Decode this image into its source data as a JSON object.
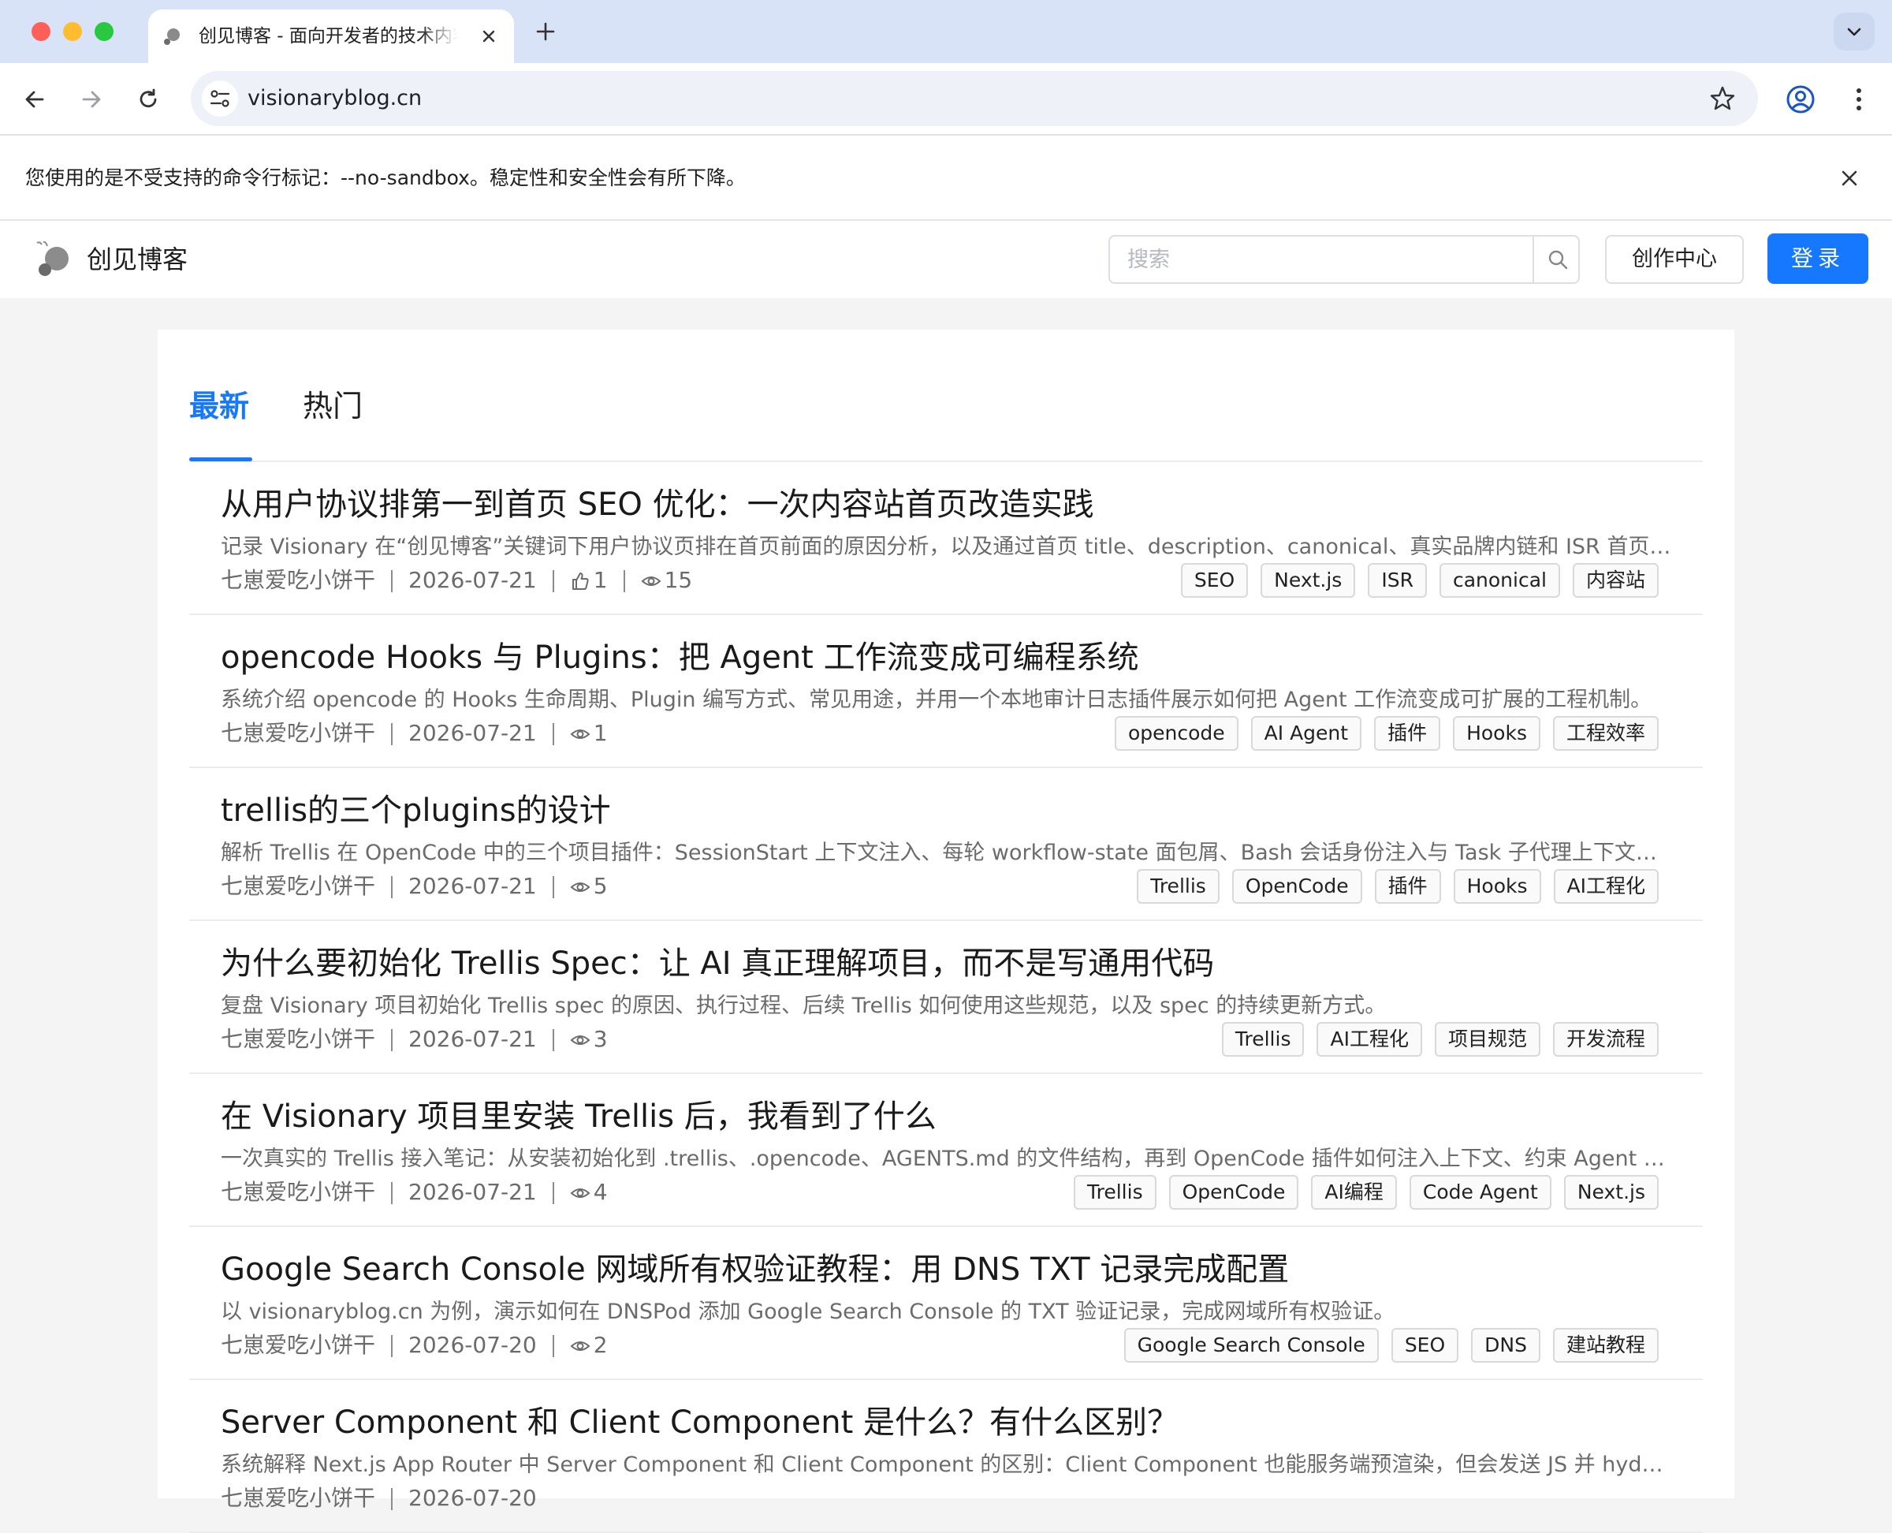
{
  "browser": {
    "tab_title": "创见博客 - 面向开发者的技术内容平台",
    "url": "visionaryblog.cn",
    "infobar_message": "您使用的是不受支持的命令行标记：--no-sandbox。稳定性和安全性会有所下降。"
  },
  "header": {
    "site_name": "创见博客",
    "search_placeholder": "搜索",
    "creator_label": "创作中心",
    "login_label": "登录"
  },
  "tabs": {
    "latest": "最新",
    "hot": "热门"
  },
  "articles": [
    {
      "title": "从用户协议排第一到首页 SEO 优化：一次内容站首页改造实践",
      "summary": "记录 Visionary 在“创见博客”关键词下用户协议页排在首页前面的原因分析，以及通过首页 title、description、canonical、真实品牌内链和 ISR 首页缓存等手段完成的首页 SEO 优化实践。",
      "author": "七崽爱吃小饼干",
      "date": "2026-07-21",
      "likes": "1",
      "views": "15",
      "tags": [
        "SEO",
        "Next.js",
        "ISR",
        "canonical",
        "内容站"
      ]
    },
    {
      "title": "opencode Hooks 与 Plugins：把 Agent 工作流变成可编程系统",
      "summary": "系统介绍 opencode 的 Hooks 生命周期、Plugin 编写方式、常见用途，并用一个本地审计日志插件展示如何把 Agent 工作流变成可扩展的工程机制。",
      "author": "七崽爱吃小饼干",
      "date": "2026-07-21",
      "views": "1",
      "tags": [
        "opencode",
        "AI Agent",
        "插件",
        "Hooks",
        "工程效率"
      ]
    },
    {
      "title": "trellis的三个plugins的设计",
      "summary": "解析 Trellis 在 OpenCode 中的三个项目插件：SessionStart 上下文注入、每轮 workflow-state 面包屑、Bash 会话身份注入与 Task 子代理上下文注入的设计思路。",
      "author": "七崽爱吃小饼干",
      "date": "2026-07-21",
      "views": "5",
      "tags": [
        "Trellis",
        "OpenCode",
        "插件",
        "Hooks",
        "AI工程化"
      ]
    },
    {
      "title": "为什么要初始化 Trellis Spec：让 AI 真正理解项目，而不是写通用代码",
      "summary": "复盘 Visionary 项目初始化 Trellis spec 的原因、执行过程、后续 Trellis 如何使用这些规范，以及 spec 的持续更新方式。",
      "author": "七崽爱吃小饼干",
      "date": "2026-07-21",
      "views": "3",
      "tags": [
        "Trellis",
        "AI工程化",
        "项目规范",
        "开发流程"
      ]
    },
    {
      "title": "在 Visionary 项目里安装 Trellis 后，我看到了什么",
      "summary": "一次真实的 Trellis 接入笔记：从安装初始化到 .trellis、.opencode、AGENTS.md 的文件结构，再到 OpenCode 插件如何注入上下文、约束 Agent 的工作流程。",
      "author": "七崽爱吃小饼干",
      "date": "2026-07-21",
      "views": "4",
      "tags": [
        "Trellis",
        "OpenCode",
        "AI编程",
        "Code Agent",
        "Next.js"
      ]
    },
    {
      "title": "Google Search Console 网域所有权验证教程：用 DNS TXT 记录完成配置",
      "summary": "以 visionaryblog.cn 为例，演示如何在 DNSPod 添加 Google Search Console 的 TXT 验证记录，完成网域所有权验证。",
      "author": "七崽爱吃小饼干",
      "date": "2026-07-20",
      "views": "2",
      "tags": [
        "Google Search Console",
        "SEO",
        "DNS",
        "建站教程"
      ]
    },
    {
      "title": "Server Component 和 Client Component 是什么？有什么区别？",
      "summary": "系统解释 Next.js App Router 中 Server Component 和 Client Component 的区别：Client Component 也能服务端预渲染，但会发送 JS 并 hydrate 后才能交互。",
      "author": "七崽爱吃小饼干",
      "date": "2026-07-20",
      "views": "",
      "tags": []
    }
  ]
}
